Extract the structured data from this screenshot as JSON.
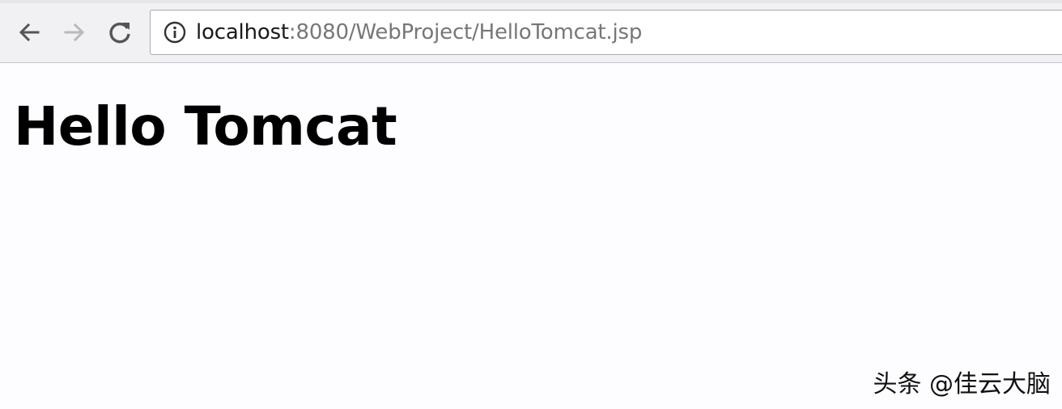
{
  "browser": {
    "address_bar": {
      "url_host": "localhost",
      "url_rest": ":8080/WebProject/HelloTomcat.jsp"
    },
    "icons": {
      "back": "arrow-left-icon",
      "forward": "arrow-right-icon",
      "reload": "reload-icon",
      "site_info": "info-icon"
    },
    "colors": {
      "toolbar_bg": "#f1f1f3",
      "page_bg": "#fdfcfe",
      "forward_disabled": "#b9b9bd"
    }
  },
  "page": {
    "heading": "Hello Tomcat"
  },
  "watermark": {
    "text": "头条 @佳云大脑"
  }
}
